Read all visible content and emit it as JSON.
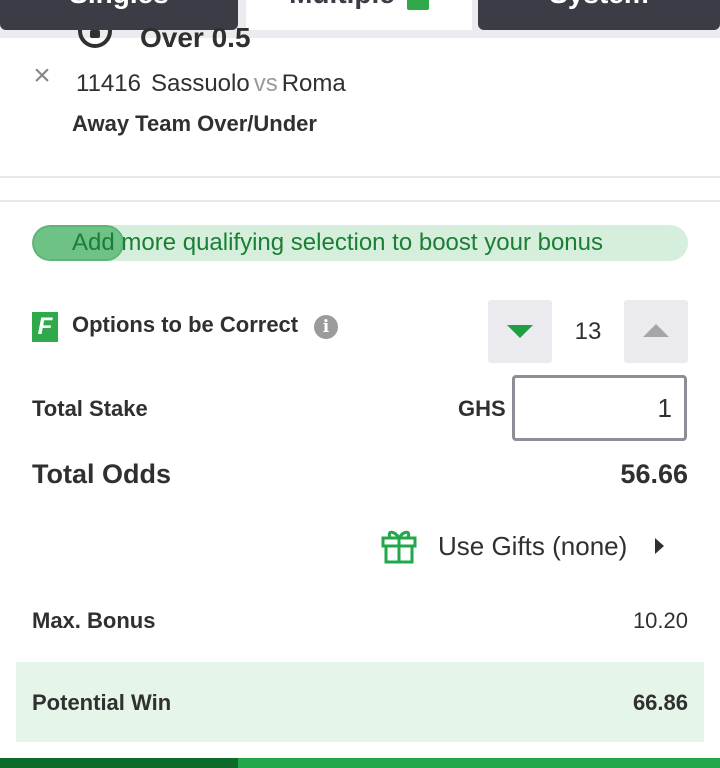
{
  "tabs": [
    {
      "label": "Singles"
    },
    {
      "label": "Multiple"
    },
    {
      "label": "System"
    }
  ],
  "selection": {
    "pick": "Over 0.5",
    "match_id": "11416",
    "home": "Sassuolo",
    "vs": "vs",
    "away": "Roma",
    "market": "Away Team Over/Under"
  },
  "bonus_progress": {
    "text": "Add more qualifying selection to boost your bonus",
    "fill_fraction": 0.14
  },
  "options": {
    "badge": "F",
    "label": "Options to be Correct",
    "info": "i",
    "value": "13"
  },
  "stake": {
    "label": "Total Stake",
    "currency": "GHS",
    "value": "1"
  },
  "odds": {
    "label": "Total Odds",
    "value": "56.66"
  },
  "gifts": {
    "label": "Use Gifts (none)"
  },
  "max_bonus": {
    "label": "Max. Bonus",
    "value": "10.20"
  },
  "potential_win": {
    "label": "Potential Win",
    "value": "66.86"
  },
  "colors": {
    "brand_green": "#20a84a",
    "dark_tab": "#3a3d45",
    "bonus_track": "#d6efdc",
    "win_bg": "#e6f5e9"
  }
}
